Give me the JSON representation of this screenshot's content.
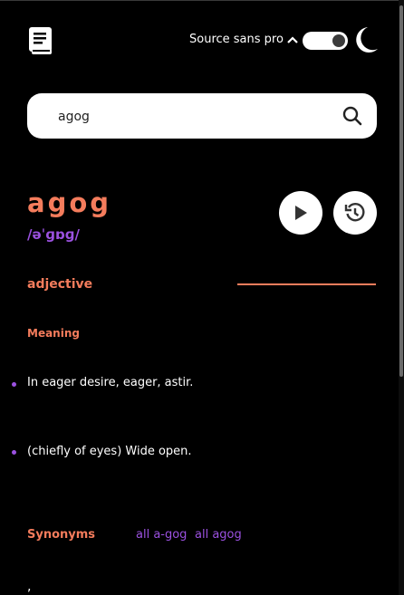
{
  "header": {
    "font_label": "Source sans pro",
    "theme": "dark",
    "icons": {
      "logo": "book-icon",
      "font_arrow": "chevron-up-icon",
      "theme": "moon-icon"
    }
  },
  "search": {
    "value": "agog",
    "placeholder": "",
    "icon": "search-icon"
  },
  "entry": {
    "word": "agog",
    "phonetic": "/əˈɡɒɡ/",
    "play_icon": "play-icon",
    "history_icon": "history-icon"
  },
  "meaning": {
    "part_of_speech": "adjective",
    "heading": "Meaning",
    "definitions": [
      "In eager desire, eager, astir.",
      "(chiefly of eyes) Wide open."
    ],
    "synonyms_label": "Synonyms",
    "synonyms": [
      "all a-gog",
      "all agog"
    ],
    "trailing": ","
  },
  "colors": {
    "accent": "#f47c5c",
    "secondary": "#9b51e0",
    "background": "#000000"
  }
}
